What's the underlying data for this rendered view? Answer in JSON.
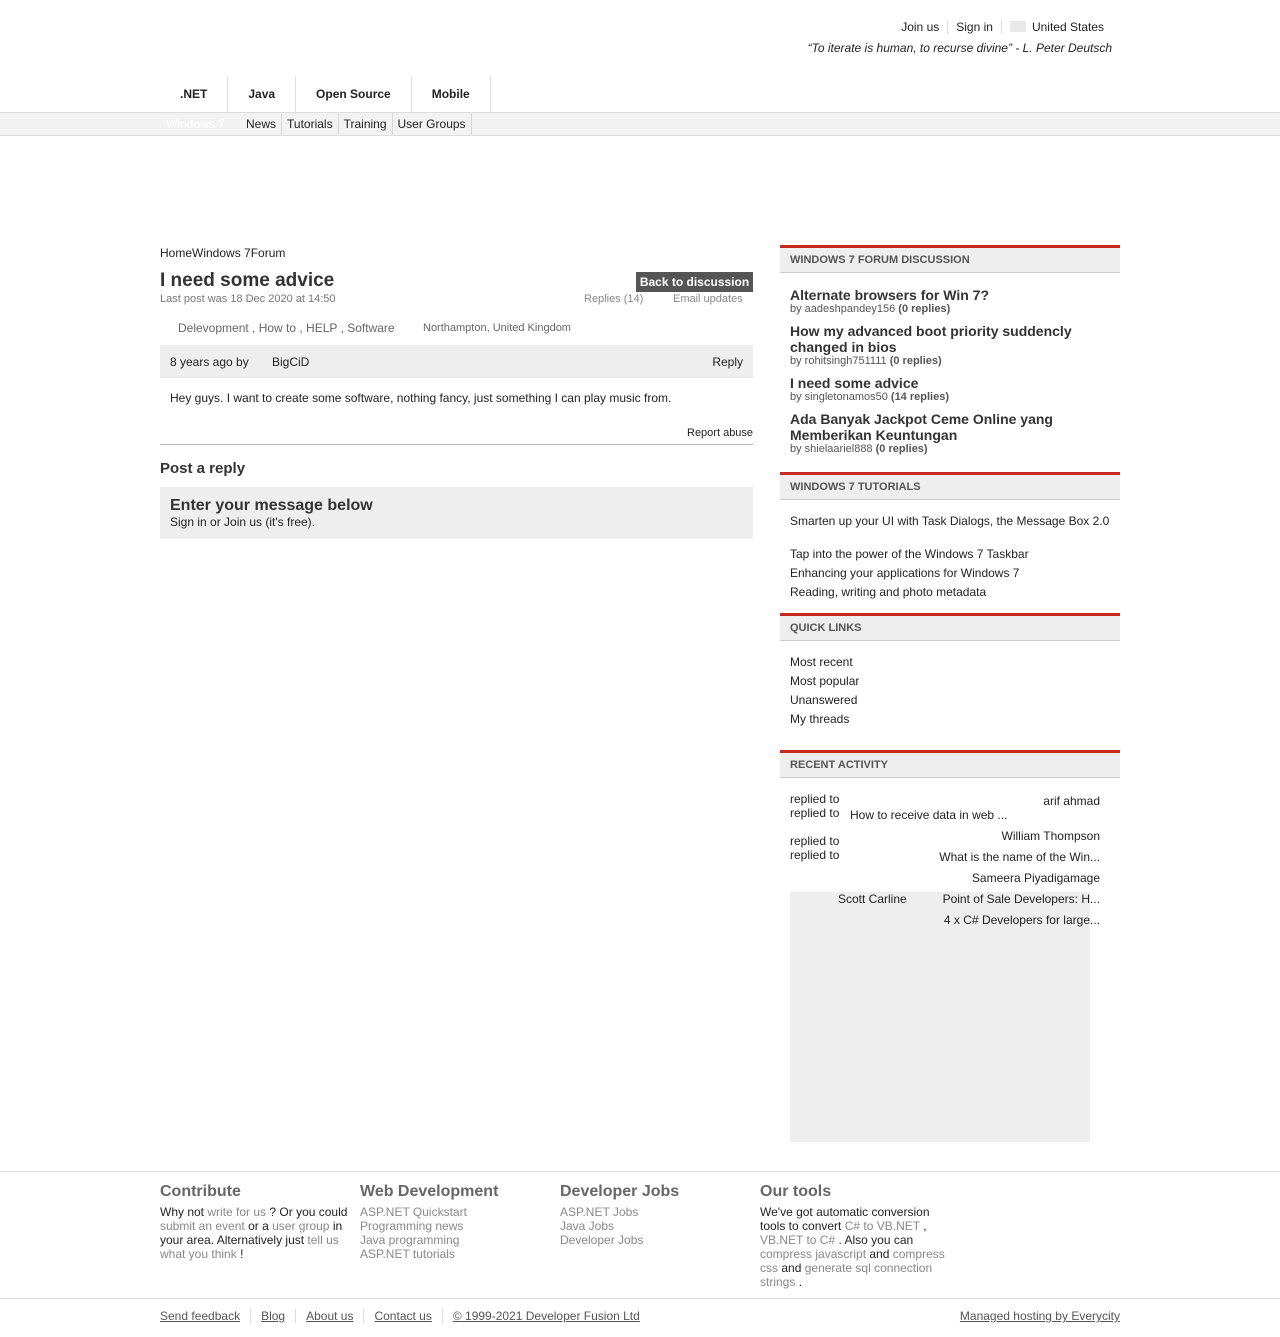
{
  "header": {
    "join": "Join us",
    "signin": "Sign in",
    "country": "United States",
    "quote": "“To iterate is human, to recurse divine” - L. Peter Deutsch"
  },
  "nav": {
    "tabs": [
      ".NET",
      "Java",
      "Open Source",
      "Mobile"
    ],
    "current": "Windows 7",
    "sub": [
      "News",
      "Tutorials",
      "Training",
      "User Groups"
    ]
  },
  "breadcrumb": [
    "Home",
    "Windows 7",
    "Forum"
  ],
  "thread": {
    "title": "I need some advice",
    "last_post": "Last post was 18 Dec 2020 at 14:50",
    "back": "Back to discussion",
    "replies": "Replies (14)",
    "email": "Email updates",
    "tags": "Delevopment , How to , HELP , Software",
    "location": "Northampton, United Kingdom",
    "ago": "8 years ago by",
    "author": "BigCiD",
    "reply": "Reply",
    "body": "Hey guys. I want to create some software, nothing fancy, just something I can play music from.",
    "report": "Report abuse"
  },
  "reply_form": {
    "heading": "Post a reply",
    "title": "Enter your message below",
    "sub": "Sign in or Join us (it's free)."
  },
  "sidebar": {
    "forum_head": "Windows 7 forum discussion",
    "discussions": [
      {
        "title": "Alternate browsers for Win 7?",
        "by": "by aadeshpandey156",
        "replies": "(0 replies)"
      },
      {
        "title": "How my advanced boot priority suddencly changed in bios",
        "by": "by rohitsingh751111",
        "replies": "(0 replies)"
      },
      {
        "title": "I need some advice",
        "by": "by singletonamos50",
        "replies": "(14 replies)"
      },
      {
        "title": "Ada Banyak Jackpot Ceme Online yang Memberikan Keuntungan",
        "by": "by shielaariel888",
        "replies": "(0 replies)"
      }
    ],
    "tutorials_head": "Windows 7 tutorials",
    "tutorials": [
      "Smarten up your UI with Task Dialogs, the Message Box 2.0",
      "Tap into the power of the Windows 7 Taskbar",
      "Enhancing your applications for Windows 7",
      "Reading, writing and photo metadata"
    ],
    "quick_head": "Quick links",
    "quick": [
      "Most recent",
      "Most popular",
      "Unanswered",
      "My threads"
    ],
    "recent_head": "Recent activity",
    "activity": {
      "replied1": "replied to",
      "replied2": "replied to",
      "replied3": "replied to",
      "replied4": "replied to",
      "u1": "arif ahmad",
      "t1": "How to receive data in web ...",
      "u2": "William Thompson",
      "t2": "What is the name of the Win...",
      "u3": "Sameera Piyadigamage",
      "u4": "Scott Carline",
      "t3": "Point of Sale Developers: H...",
      "t4": "4 x C# Developers for large..."
    }
  },
  "footer": {
    "contribute": {
      "h": "Contribute",
      "t1": "Why not",
      "l1": "write for us",
      "t2": "? Or you could",
      "l2": "submit an event",
      "t3": "or a",
      "l3": "user group",
      "t4": "in your area. Alternatively just",
      "l4": "tell us what you think",
      "t5": "!"
    },
    "webdev": {
      "h": "Web Development",
      "links": [
        "ASP.NET Quickstart",
        "Programming news",
        "Java programming",
        "ASP.NET tutorials"
      ]
    },
    "jobs": {
      "h": "Developer Jobs",
      "links": [
        "ASP.NET Jobs",
        "Java Jobs",
        "Developer Jobs"
      ]
    },
    "tools": {
      "h": "Our tools",
      "t1": "We've got automatic conversion tools to convert",
      "l1": "C# to VB.NET",
      "t2": ",",
      "l2": "VB.NET to C#",
      "t3": ". Also you can",
      "l3": "compress javascript",
      "t4": "and",
      "l4": "compress css",
      "t5": "and",
      "l5": "generate sql connection strings",
      "t6": "."
    },
    "bottom": [
      "Send feedback",
      "Blog",
      "About us",
      "Contact us",
      "© 1999-2021 Developer Fusion Ltd"
    ],
    "hosting": "Managed hosting by Everycity"
  }
}
